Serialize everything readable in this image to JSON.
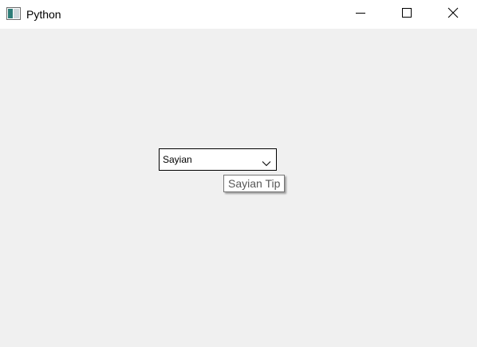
{
  "window": {
    "title": "Python",
    "icon": "app-window-icon",
    "controls": [
      "minimize-icon",
      "maximize-icon",
      "close-icon"
    ]
  },
  "combo": {
    "selected": "Sayian",
    "icon": "chevron-down-icon"
  },
  "tooltip": {
    "text": "Sayian Tip"
  },
  "colors": {
    "background": "#f0f0f0",
    "titlebar": "#ffffff",
    "tooltip_text": "#575757"
  }
}
